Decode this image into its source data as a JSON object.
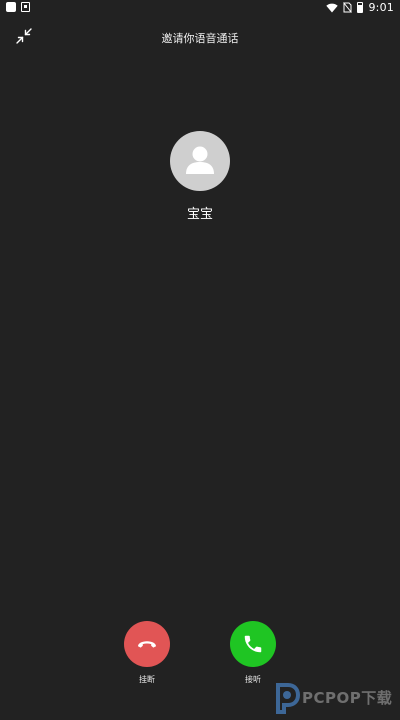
{
  "status_bar": {
    "time": "9:01",
    "icons": [
      "notification-square-icon",
      "app-notification-icon",
      "wifi-icon",
      "no-sim-icon",
      "battery-icon"
    ]
  },
  "call": {
    "title": "邀请你语音通话",
    "caller_name": "宝宝",
    "avatar_icon": "default-avatar-icon",
    "minimize_icon": "minimize-arrows-icon"
  },
  "actions": {
    "decline_label": "挂断",
    "accept_label": "接听",
    "decline_icon": "hang-up-phone-icon",
    "accept_icon": "phone-icon"
  },
  "colors": {
    "background": "#222222",
    "decline": "#e15555",
    "accept": "#1fc523",
    "avatar_bg": "#cfcfcf"
  },
  "watermark": {
    "text": "PCPOP下载"
  }
}
